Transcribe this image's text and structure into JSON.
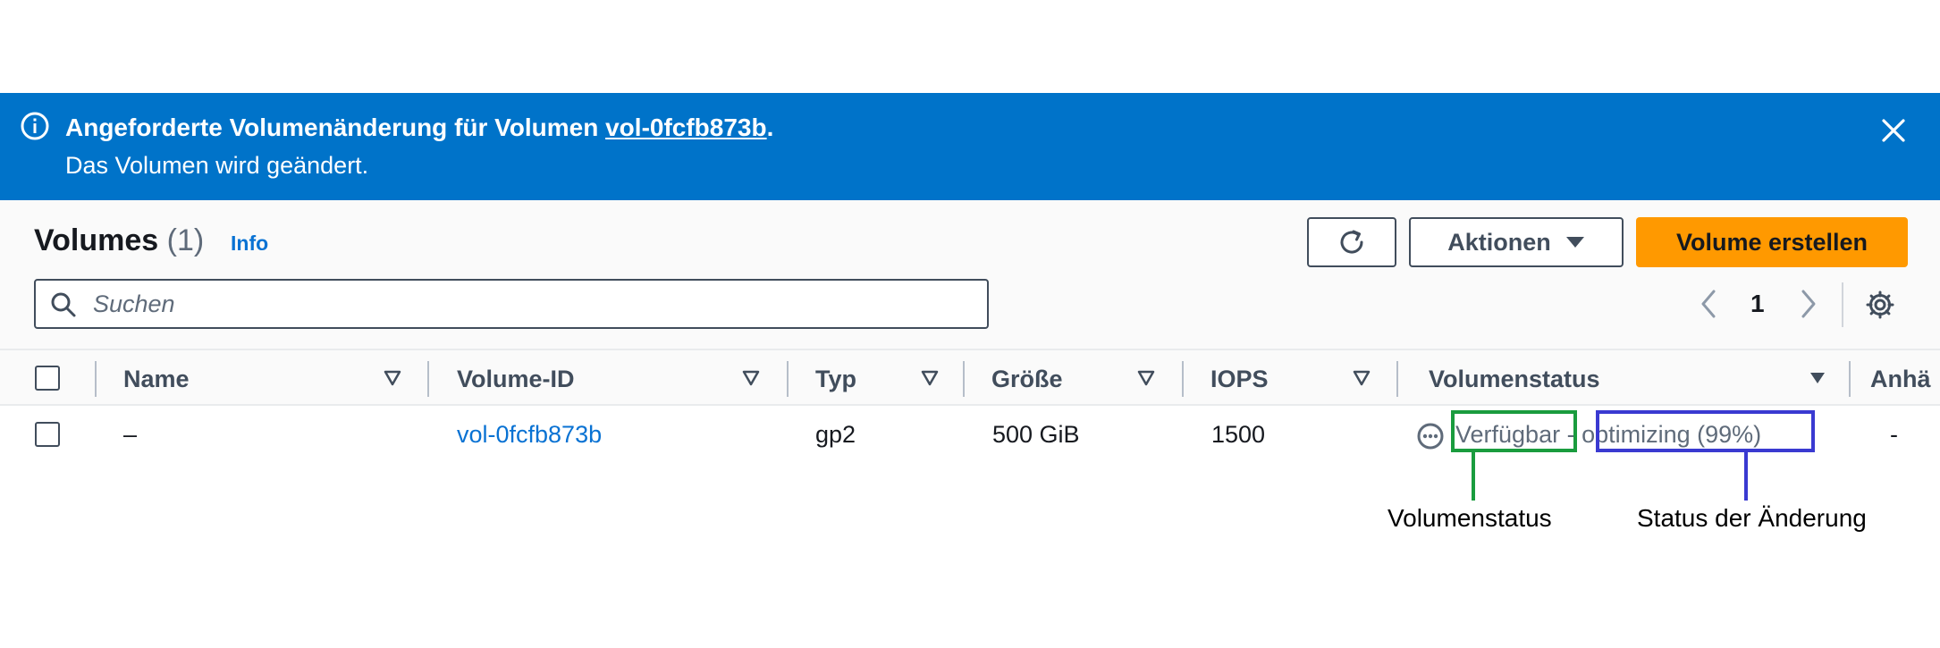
{
  "banner": {
    "title_prefix": "Angeforderte Volumenänderung für Volumen ",
    "title_link": "vol-0fcfb873b",
    "title_suffix": ".",
    "message": "Das Volumen wird geändert.",
    "icon": "info-icon",
    "close_icon": "close-icon",
    "color": "#0073c9"
  },
  "header": {
    "title": "Volumes",
    "count": "(1)",
    "info_link": "Info"
  },
  "toolbar": {
    "refresh_icon": "refresh-icon",
    "actions_label": "Aktionen",
    "create_label": "Volume erstellen",
    "create_color": "#ff9900"
  },
  "search": {
    "placeholder": "Suchen",
    "value": ""
  },
  "pagination": {
    "current_page": "1"
  },
  "table": {
    "columns": [
      "Name",
      "Volume-ID",
      "Typ",
      "Größe",
      "IOPS",
      "Volumenstatus",
      "Anhä"
    ],
    "rows": [
      {
        "name": "–",
        "volume_id": "vol-0fcfb873b",
        "type": "gp2",
        "size": "500 GiB",
        "iops": "1500",
        "status": "Verfügbar",
        "status_separator": " - ",
        "modification_status": "optimizing (99%)",
        "attached": "-"
      }
    ]
  },
  "annotations": {
    "volume_status_label": "Volumenstatus",
    "modification_status_label": "Status der Änderung",
    "volume_status_color": "#1a9c3e",
    "modification_status_color": "#3a3ad1"
  }
}
